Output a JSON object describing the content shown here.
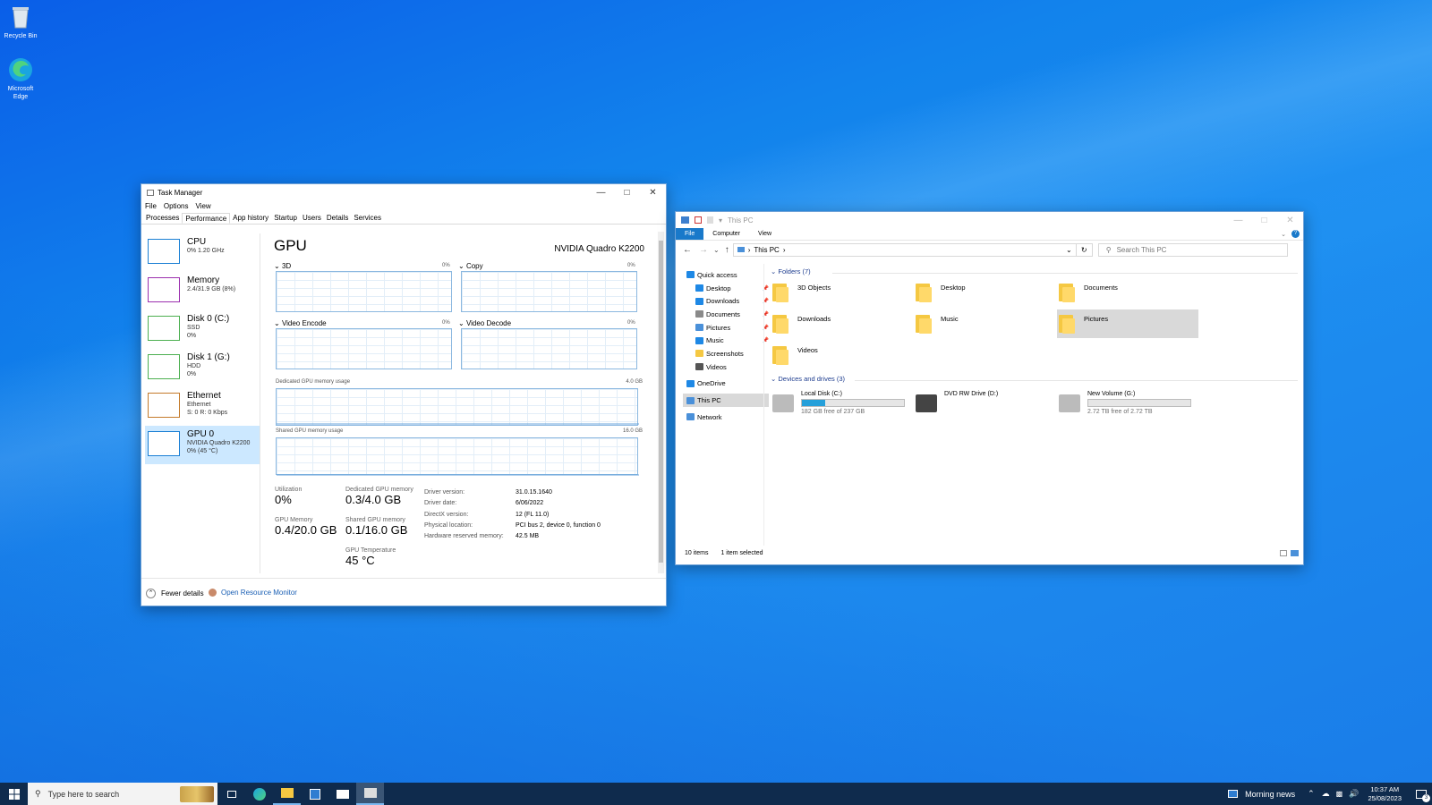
{
  "desktop": {
    "icons": [
      {
        "label": "Recycle Bin"
      },
      {
        "label": "Microsoft Edge"
      }
    ]
  },
  "task_manager": {
    "title": "Task Manager",
    "menu": [
      "File",
      "Options",
      "View"
    ],
    "tabs": [
      "Processes",
      "Performance",
      "App history",
      "Startup",
      "Users",
      "Details",
      "Services"
    ],
    "sidebar": [
      {
        "name": "CPU",
        "l1": "0%  1.20 GHz",
        "l2": "",
        "color": "#1a7fd4"
      },
      {
        "name": "Memory",
        "l1": "2.4/31.9 GB (8%)",
        "l2": "",
        "color": "#9b2fae"
      },
      {
        "name": "Disk 0 (C:)",
        "l1": "SSD",
        "l2": "0%",
        "color": "#4caf50"
      },
      {
        "name": "Disk 1 (G:)",
        "l1": "HDD",
        "l2": "0%",
        "color": "#4caf50"
      },
      {
        "name": "Ethernet",
        "l1": "Ethernet",
        "l2": "S: 0  R: 0 Kbps",
        "color": "#c47a2a"
      },
      {
        "name": "GPU 0",
        "l1": "NVIDIA Quadro K2200",
        "l2": "0%  (45 °C)",
        "color": "#1a7fd4"
      }
    ],
    "gpu": {
      "heading": "GPU",
      "model": "NVIDIA Quadro K2200",
      "engines": [
        {
          "name": "3D",
          "pct": "0%"
        },
        {
          "name": "Copy",
          "pct": "0%"
        },
        {
          "name": "Video Encode",
          "pct": "0%"
        },
        {
          "name": "Video Decode",
          "pct": "0%"
        }
      ],
      "dedicated_label": "Dedicated GPU memory usage",
      "dedicated_max": "4.0 GB",
      "shared_label": "Shared GPU memory usage",
      "shared_max": "16.0 GB",
      "stats": {
        "util_l": "Utilization",
        "util_v": "0%",
        "ded_l": "Dedicated GPU memory",
        "ded_v": "0.3/4.0 GB",
        "gmem_l": "GPU Memory",
        "gmem_v": "0.4/20.0 GB",
        "sh_l": "Shared GPU memory",
        "sh_v": "0.1/16.0 GB",
        "temp_l": "GPU Temperature",
        "temp_v": "45 °C"
      },
      "details": [
        {
          "k": "Driver version:",
          "v": "31.0.15.1640"
        },
        {
          "k": "Driver date:",
          "v": "6/06/2022"
        },
        {
          "k": "DirectX version:",
          "v": "12 (FL 11.0)"
        },
        {
          "k": "Physical location:",
          "v": "PCI bus 2, device 0, function 0"
        },
        {
          "k": "Hardware reserved memory:",
          "v": "42.5 MB"
        }
      ]
    },
    "fewer_details": "Fewer details",
    "resource_monitor": "Open Resource Monitor"
  },
  "explorer": {
    "title": "This PC",
    "ribbon": [
      "File",
      "Computer",
      "View"
    ],
    "address": "This PC",
    "search_placeholder": "Search This PC",
    "nav": [
      {
        "label": "Quick access",
        "color": "#1e88e5",
        "indent": 0
      },
      {
        "label": "Desktop",
        "color": "#1e88e5",
        "indent": 1
      },
      {
        "label": "Downloads",
        "color": "#1e88e5",
        "indent": 1
      },
      {
        "label": "Documents",
        "color": "#8a8a8a",
        "indent": 1
      },
      {
        "label": "Pictures",
        "color": "#4a90d9",
        "indent": 1
      },
      {
        "label": "Music",
        "color": "#1e88e5",
        "indent": 1
      },
      {
        "label": "Screenshots",
        "color": "#f5c842",
        "indent": 1
      },
      {
        "label": "Videos",
        "color": "#555",
        "indent": 1
      },
      {
        "label": "OneDrive",
        "color": "#1e88e5",
        "indent": 0
      },
      {
        "label": "This PC",
        "color": "#4a90d9",
        "indent": 0
      },
      {
        "label": "Network",
        "color": "#4a90d9",
        "indent": 0
      }
    ],
    "folders_header": "Folders (7)",
    "folders": [
      "3D Objects",
      "Desktop",
      "Documents",
      "Downloads",
      "Music",
      "Pictures",
      "Videos"
    ],
    "drives_header": "Devices and drives (3)",
    "drives": [
      {
        "name": "Local Disk (C:)",
        "free": "182 GB free of 237 GB",
        "used_fraction": 0.23
      },
      {
        "name": "DVD RW Drive (D:)",
        "free": "",
        "used_fraction": null
      },
      {
        "name": "New Volume (G:)",
        "free": "2.72 TB free of 2.72 TB",
        "used_fraction": 0.0
      }
    ],
    "status_items": "10 items",
    "status_selected": "1 item selected"
  },
  "taskbar": {
    "search_placeholder": "Type here to search",
    "news": "Morning news",
    "time": "10:37 AM",
    "date": "25/08/2023",
    "notif_count": "3"
  }
}
